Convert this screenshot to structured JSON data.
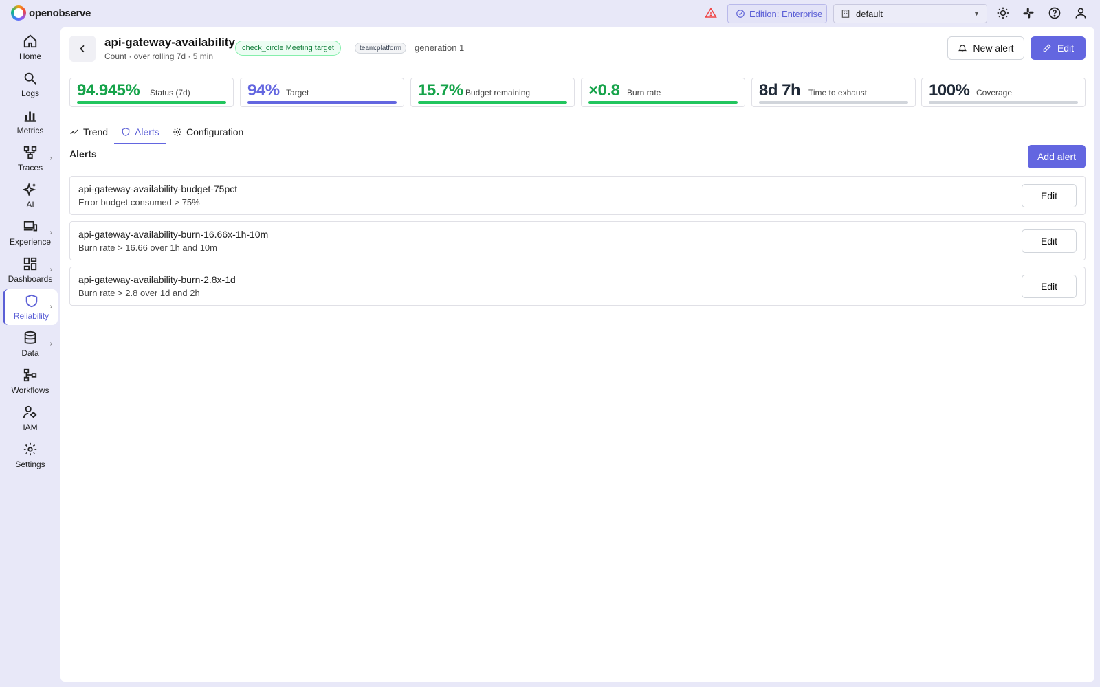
{
  "brand": {
    "name": "openobserve"
  },
  "topbar": {
    "edition": "Edition: Enterprise",
    "org": "default"
  },
  "sidebar": {
    "items": [
      {
        "label": "Home",
        "icon": "home-icon"
      },
      {
        "label": "Logs",
        "icon": "search-icon"
      },
      {
        "label": "Metrics",
        "icon": "bar-chart-icon"
      },
      {
        "label": "Traces",
        "icon": "traces-icon"
      },
      {
        "label": "AI",
        "icon": "sparkle-icon"
      },
      {
        "label": "Experience",
        "icon": "devices-icon"
      },
      {
        "label": "Dashboards",
        "icon": "dashboard-icon"
      },
      {
        "label": "Reliability",
        "icon": "shield-icon"
      },
      {
        "label": "Data",
        "icon": "database-icon"
      },
      {
        "label": "Workflows",
        "icon": "workflow-icon"
      },
      {
        "label": "IAM",
        "icon": "user-key-icon"
      },
      {
        "label": "Settings",
        "icon": "gear-icon"
      }
    ],
    "active": "Reliability"
  },
  "header": {
    "title": "api-gateway-availability",
    "subtitle": "Count · over rolling 7d · 5 min",
    "status_badge": "check_circle  Meeting target",
    "team_tag": "team:platform",
    "generation": "generation 1",
    "new_alert_label": "New alert",
    "edit_label": "Edit"
  },
  "stats": [
    {
      "value": "94.945%",
      "label": "Status (7d)",
      "color": "#16a34a",
      "bar_color": "#22c55e",
      "fill": 1.0
    },
    {
      "value": "94%",
      "label": "Target",
      "color": "#6366e0",
      "bar_color": "#6366e0",
      "fill": 1.0
    },
    {
      "value": "15.7%",
      "label": "Budget remaining",
      "color": "#16a34a",
      "bar_color": "#22c55e",
      "fill": 1.0
    },
    {
      "value": "×0.8",
      "label": "Burn rate",
      "color": "#16a34a",
      "bar_color": "#22c55e",
      "fill": 1.0
    },
    {
      "value": "8d 7h",
      "label": "Time to exhaust",
      "color": "#1f2937",
      "bar_color": "#d1d5db",
      "fill": 1.0
    },
    {
      "value": "100%",
      "label": "Coverage",
      "color": "#1f2937",
      "bar_color": "#d1d5db",
      "fill": 1.0
    }
  ],
  "tabs": [
    {
      "label": "Trend",
      "icon": "trend-icon"
    },
    {
      "label": "Alerts",
      "icon": "shield-icon"
    },
    {
      "label": "Configuration",
      "icon": "gear-icon"
    }
  ],
  "active_tab": "Alerts",
  "alerts_section": {
    "title": "Alerts",
    "add_label": "Add alert",
    "edit_label": "Edit",
    "items": [
      {
        "name": "api-gateway-availability-budget-75pct",
        "desc": "Error budget consumed > 75%"
      },
      {
        "name": "api-gateway-availability-burn-16.66x-1h-10m",
        "desc": "Burn rate > 16.66 over 1h and 10m"
      },
      {
        "name": "api-gateway-availability-burn-2.8x-1d",
        "desc": "Burn rate > 2.8 over 1d and 2h"
      }
    ]
  }
}
